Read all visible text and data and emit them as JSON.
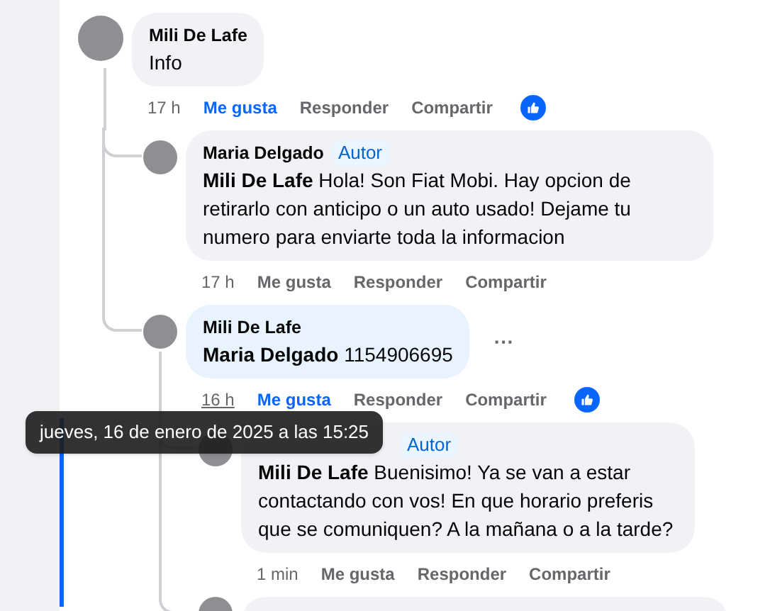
{
  "comments": [
    {
      "kind": "comment",
      "author": "Mili De Lafe",
      "text": "Info",
      "time": "17 h",
      "actions": {
        "like": "Me gusta",
        "reply": "Responder",
        "share": "Compartir"
      },
      "liked": true,
      "has_reaction": true,
      "children": [
        {
          "kind": "comment",
          "author": "Maria Delgado",
          "badge": "Autor",
          "text": "**Mili De Lafe** Hola! Son Fiat Mobi. Hay opcion de retirarlo con anticipo o un auto usado! Dejame tu numero para enviarte toda la informacion",
          "time": "17 h",
          "actions": {
            "like": "Me gusta",
            "reply": "Responder",
            "share": "Compartir"
          },
          "liked": false
        },
        {
          "kind": "comment",
          "author": "Mili De Lafe",
          "text": "**Maria Delgado** 1154906695",
          "time": "16 h",
          "time_hovered": true,
          "time_tooltip": "jueves, 16 de enero de 2025 a las 15:25",
          "more": "···",
          "highlighted": true,
          "actions": {
            "like": "Me gusta",
            "reply": "Responder",
            "share": "Compartir"
          },
          "liked": true,
          "has_reaction": true,
          "children": [
            {
              "kind": "comment",
              "badge": "Autor",
              "text": "**Mili De Lafe** Buenisimo! Ya se van a estar contactando con vos! En que horario preferis que se comuniquen? A la mañana o a la tarde?",
              "time": "1 min",
              "focused": true,
              "actions": {
                "like": "Me gusta",
                "reply": "Responder",
                "share": "Compartir"
              },
              "liked": false
            },
            {
              "kind": "cut_off"
            }
          ]
        }
      ]
    }
  ]
}
